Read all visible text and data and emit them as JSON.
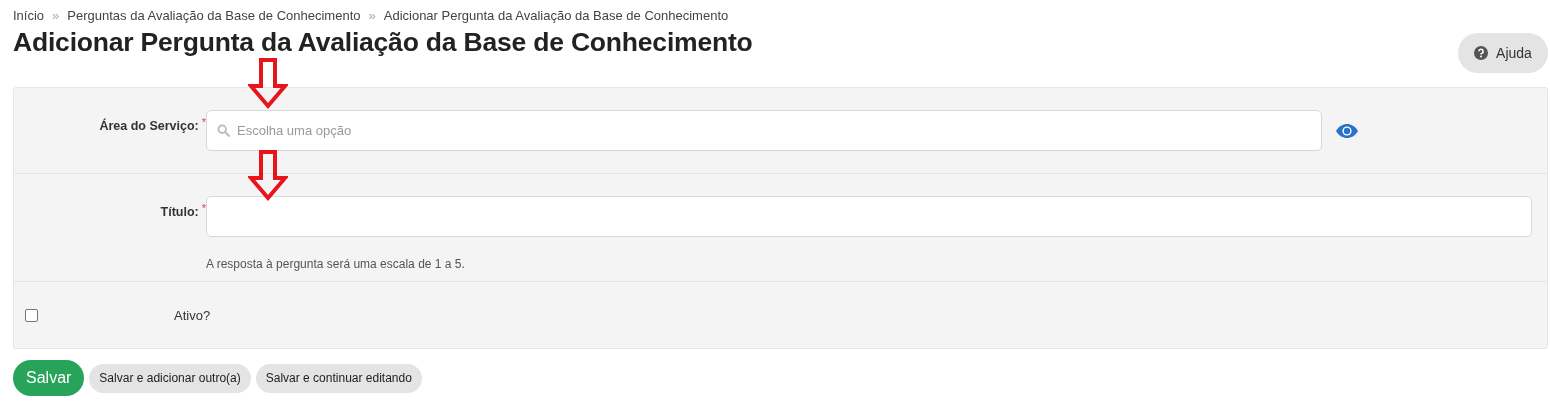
{
  "breadcrumb": [
    {
      "kind": "link",
      "label": "Início"
    },
    {
      "kind": "separator",
      "label": "»"
    },
    {
      "kind": "link",
      "label": "Perguntas da Avaliação da Base de Conhecimento"
    },
    {
      "kind": "separator",
      "label": "»"
    },
    {
      "kind": "current",
      "label": "Adicionar Pergunta da Avaliação da Base de Conhecimento"
    }
  ],
  "title": "Adicionar Pergunta da Avaliação da Base de Conhecimento",
  "help_button": {
    "label": "Ajuda"
  },
  "form": {
    "rows": [
      {
        "kind": "select",
        "label": "Área do Serviço:",
        "required_mark": "*",
        "placeholder": "Escolha uma opção"
      },
      {
        "kind": "text",
        "label": "Título:",
        "required_mark": "*",
        "help": "A resposta à pergunta será uma escala de 1 a 5."
      },
      {
        "kind": "checkbox",
        "label": "Ativo?",
        "checked": false
      }
    ]
  },
  "buttons": [
    {
      "label": "Salvar",
      "primary": true
    },
    {
      "label": "Salvar e adicionar outro(a)",
      "primary": false
    },
    {
      "label": "Salvar e continuar editando",
      "primary": false
    }
  ]
}
